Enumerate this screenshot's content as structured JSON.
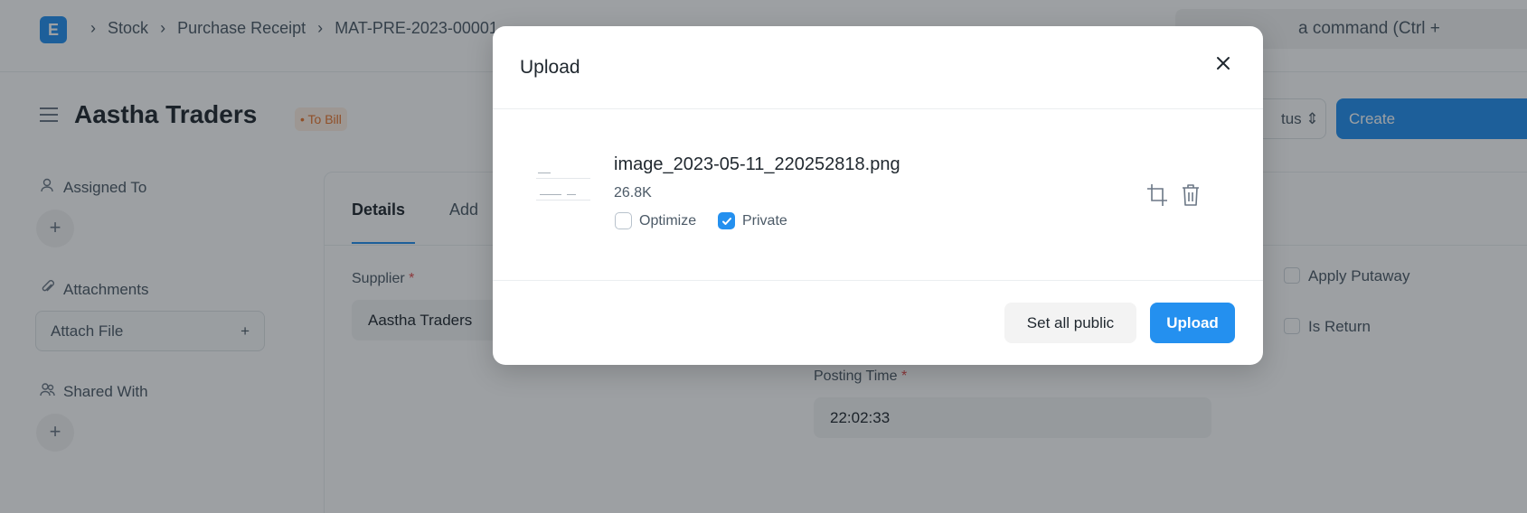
{
  "app": {
    "logo_letter": "E"
  },
  "breadcrumbs": [
    "Stock",
    "Purchase Receipt",
    "MAT-PRE-2023-00001"
  ],
  "search": {
    "text": "a command (Ctrl +"
  },
  "doc": {
    "title": "Aastha Traders",
    "status": "To Bill"
  },
  "actions": {
    "status_label": "tus",
    "create_label": "Create"
  },
  "sidebar": {
    "assigned_to": "Assigned To",
    "attachments": "Attachments",
    "attach_file": "Attach File",
    "shared_with": "Shared With"
  },
  "form": {
    "tabs": [
      "Details",
      "Add"
    ],
    "supplier_label": "Supplier",
    "supplier_value": "Aastha Traders",
    "apply_putaway": "Apply Putaway",
    "is_return": "Is Return",
    "posting_time_label": "Posting Time",
    "posting_time_value": "22:02:33"
  },
  "modal": {
    "title": "Upload",
    "file": {
      "name": "image_2023-05-11_220252818.png",
      "size": "26.8K",
      "optimize_label": "Optimize",
      "optimize_checked": false,
      "private_label": "Private",
      "private_checked": true
    },
    "set_public_label": "Set all public",
    "upload_label": "Upload"
  },
  "colors": {
    "accent": "#2490ef",
    "status": "#e8742c",
    "overlay": "rgba(22,28,36,0.42)"
  }
}
